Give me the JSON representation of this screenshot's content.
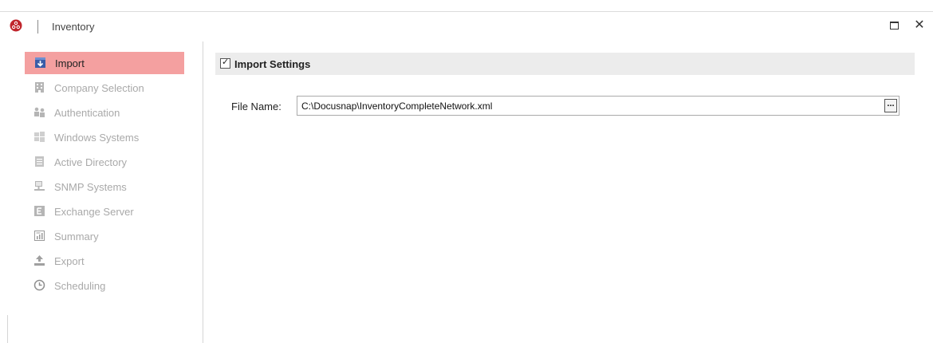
{
  "window": {
    "title": "Inventory"
  },
  "sidebar": {
    "items": [
      {
        "label": "Import",
        "icon": "import-icon",
        "active": true
      },
      {
        "label": "Company Selection",
        "icon": "building-icon",
        "active": false
      },
      {
        "label": "Authentication",
        "icon": "users-icon",
        "active": false
      },
      {
        "label": "Windows Systems",
        "icon": "windows-icon",
        "active": false
      },
      {
        "label": "Active Directory",
        "icon": "directory-icon",
        "active": false
      },
      {
        "label": "SNMP Systems",
        "icon": "network-icon",
        "active": false
      },
      {
        "label": "Exchange Server",
        "icon": "exchange-icon",
        "active": false
      },
      {
        "label": "Summary",
        "icon": "summary-icon",
        "active": false
      },
      {
        "label": "Export",
        "icon": "export-icon",
        "active": false
      },
      {
        "label": "Scheduling",
        "icon": "clock-icon",
        "active": false
      }
    ]
  },
  "main": {
    "section_title": "Import Settings",
    "section_checked": true,
    "file_name_label": "File Name:",
    "file_name_value": "C:\\Docusnap\\InventoryCompleteNetwork.xml",
    "browse_label": "..."
  },
  "colors": {
    "accent": "#f4a0a0",
    "brand": "#c0262d",
    "disabled_text": "#a9a9a9"
  }
}
